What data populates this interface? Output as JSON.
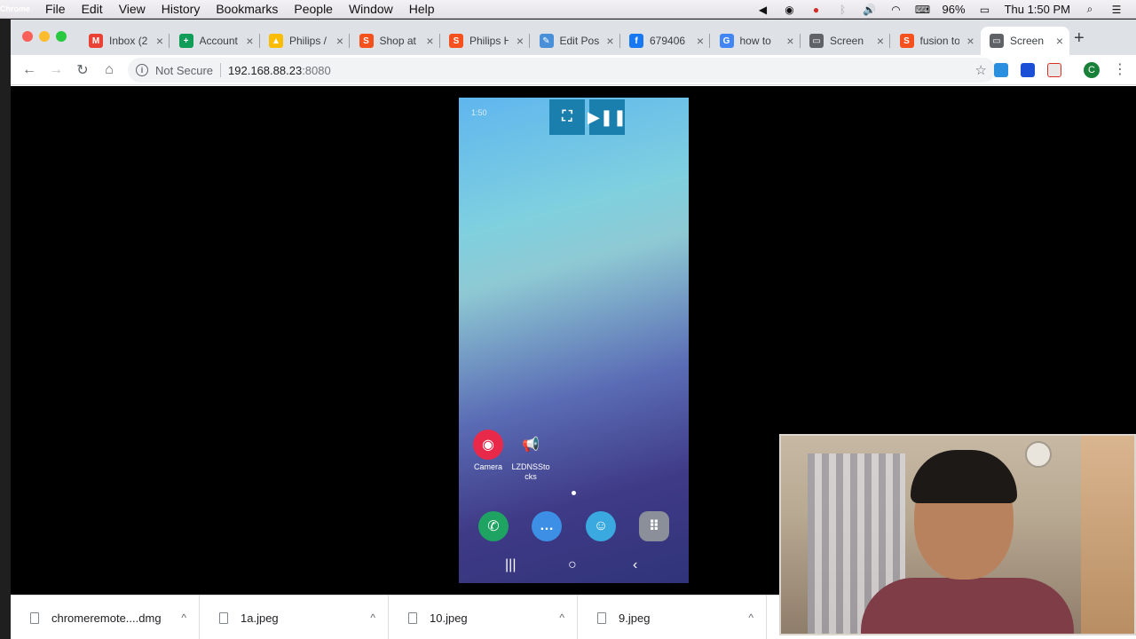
{
  "menubar": {
    "app": "Chrome",
    "items": [
      "File",
      "Edit",
      "View",
      "History",
      "Bookmarks",
      "People",
      "Window",
      "Help"
    ],
    "battery": "96%",
    "clock": "Thu 1:50 PM"
  },
  "tabs": [
    {
      "title": "Inbox (2",
      "icon": "gmail-icon",
      "color": "#ea4335",
      "glyph": "M"
    },
    {
      "title": "Account",
      "icon": "sheets-icon",
      "color": "#0f9d58",
      "glyph": "+"
    },
    {
      "title": "Philips /",
      "icon": "drive-icon",
      "color": "#fbbc04",
      "glyph": "▲"
    },
    {
      "title": "Shop at",
      "icon": "shopee-icon",
      "color": "#f4511e",
      "glyph": "S"
    },
    {
      "title": "Philips H",
      "icon": "shopee-icon",
      "color": "#f4511e",
      "glyph": "S"
    },
    {
      "title": "Edit Pos",
      "icon": "edit-post-icon",
      "color": "#4a90d9",
      "glyph": "✎"
    },
    {
      "title": "679406",
      "icon": "facebook-icon",
      "color": "#1877f2",
      "glyph": "f"
    },
    {
      "title": "how to",
      "icon": "google-icon",
      "color": "#4285f4",
      "glyph": "G"
    },
    {
      "title": "Screen",
      "icon": "cast-icon",
      "color": "#5f6368",
      "glyph": "▭"
    },
    {
      "title": "fusion to",
      "icon": "shopee-icon",
      "color": "#f4511e",
      "glyph": "S"
    },
    {
      "title": "Screen",
      "icon": "cast-icon",
      "color": "#5f6368",
      "glyph": "▭"
    }
  ],
  "omnibox": {
    "security": "Not Secure",
    "host": "192.168.88.23",
    "port": ":8080"
  },
  "profile_initial": "C",
  "phone": {
    "status_time": "1:50",
    "apps": [
      {
        "label": "Camera",
        "icon": "camera-icon",
        "color": "#e8294a"
      },
      {
        "label": "LZDNSStocks",
        "icon": "megaphone-icon",
        "color": "#3d8fd6"
      }
    ],
    "dock": [
      {
        "icon": "phone-icon",
        "color": "#1ea362"
      },
      {
        "icon": "messages-icon",
        "color": "#3d8fe6"
      },
      {
        "icon": "waze-icon",
        "color": "#3aa9e0"
      },
      {
        "icon": "app-drawer-icon",
        "color": "#8a8f99"
      }
    ]
  },
  "downloads": [
    {
      "name": "chromeremote....dmg"
    },
    {
      "name": "1a.jpeg"
    },
    {
      "name": "10.jpeg"
    },
    {
      "name": "9.jpeg"
    }
  ]
}
